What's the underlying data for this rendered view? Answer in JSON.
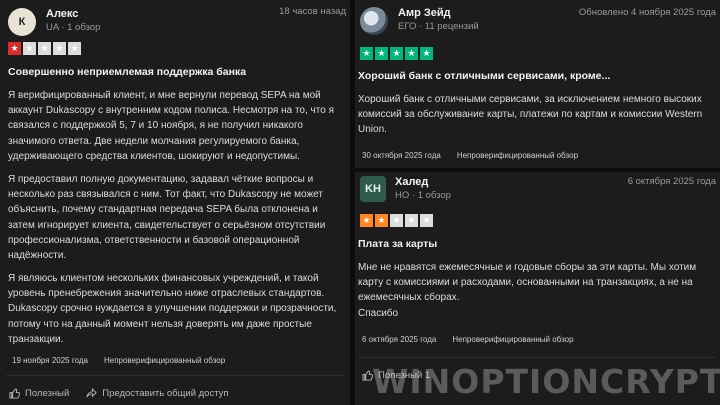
{
  "left_review": {
    "avatar_letter": "К",
    "name": "Алекс",
    "sub": "UA · 1 обзор",
    "time": "18 часов назад",
    "rating": 1,
    "title": "Совершенно неприемлемая поддержка банка",
    "paragraphs": [
      "Я верифицированный клиент, и мне вернули перевод SEPA на мой аккаунт Dukascopy с внутренним кодом полиса. Несмотря на то, что я связался с поддержкой 5, 7 и 10 ноября, я не получил никакого значимого ответа. Две недели молчания регулируемого банка, удерживающего средства клиентов, шокируют и недопустимы.",
      "Я предоставил полную документацию, задавал чёткие вопросы и несколько раз связывался с ним. Тот факт, что Dukascopy не может объяснить, почему стандартная передача SEPA была отклонена и затем игнорирует клиента, свидетельствует о серьёзном отсутствии профессионализма, ответственности и базовой операционной надёжности.",
      "Я являюсь клиентом нескольких финансовых учреждений, и такой уровень пренебрежения значительно ниже отраслевых стандартов. Dukascopy срочно нуждается в улучшении поддержки и прозрачности, потому что на данный момент нельзя доверять им даже простые транзакции."
    ],
    "review_date": "19 ноября 2025 года",
    "status": "Непроверифицированный обзор",
    "useful_label": "Полезный",
    "share_label": "Предоставить общий доступ"
  },
  "right_top_review": {
    "name": "Амр Зейд",
    "sub": "ЕГО · 11 рецензий",
    "updated": "Обновлено 4 ноября 2025 года",
    "rating": 5,
    "title": "Хороший банк с отличными сервисами, кроме...",
    "body": "Хороший банк с отличными сервисами, за исключением немного высоких комиссий за обслуживание карты, платежи по картам и комиссии Western Union.",
    "review_date": "30 октября 2025 года",
    "status": "Непроверифицированный обзор"
  },
  "right_bottom_review": {
    "avatar_letters": "KH",
    "name": "Халед",
    "sub": "НО · 1 обзор",
    "time": "6 октября 2025 года",
    "rating": 2,
    "title": "Плата за карты",
    "body": "Мне не нравятся ежемесячные и годовые сборы за эти карты. Мы хотим карту с комиссиями и расходами, основанными на транзакциях, а не на ежемесячных сборах.",
    "closing": "Спасибо",
    "review_date": "6 октября 2025 года",
    "status": "Непроверифицированный обзор",
    "useful_label": "Полезный 1"
  },
  "watermark": "WINOPTIONCRYPTO.COM",
  "colors": {
    "star_red": "#d92b2b",
    "star_green": "#00b67a",
    "star_orange": "#ff8622",
    "star_empty": "#dcdcdc",
    "card_bg": "#1c1c1c"
  }
}
